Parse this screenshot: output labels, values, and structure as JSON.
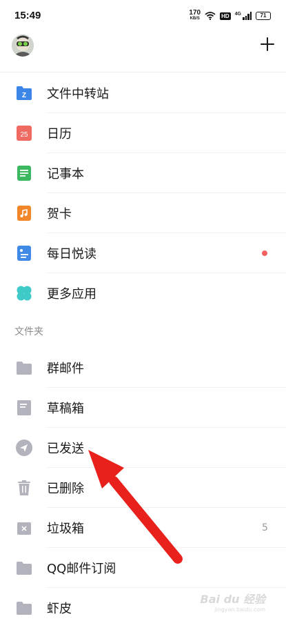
{
  "status_bar": {
    "time": "15:49",
    "net_speed_value": "170",
    "net_speed_unit": "KB/S",
    "hd": "HD",
    "network": "4G",
    "battery": "71"
  },
  "header": {
    "avatar": "avatar",
    "add_icon": "plus-icon"
  },
  "apps": [
    {
      "label": "文件中转站",
      "icon": "file-transfer-icon",
      "color": "#3b86e6"
    },
    {
      "label": "日历",
      "icon": "calendar-icon",
      "color": "#ef6b62",
      "icon_text": "25"
    },
    {
      "label": "记事本",
      "icon": "notepad-icon",
      "color": "#3cb861"
    },
    {
      "label": "贺卡",
      "icon": "greeting-card-icon",
      "color": "#f2872a"
    },
    {
      "label": "每日悦读",
      "icon": "daily-reading-icon",
      "color": "#3f8ae6",
      "has_dot": true
    },
    {
      "label": "更多应用",
      "icon": "more-apps-icon",
      "color": "#3fc9c7"
    }
  ],
  "folders_title": "文件夹",
  "folders": [
    {
      "label": "群邮件",
      "icon": "folder-icon"
    },
    {
      "label": "草稿箱",
      "icon": "drafts-icon"
    },
    {
      "label": "已发送",
      "icon": "sent-icon"
    },
    {
      "label": "已删除",
      "icon": "trash-icon"
    },
    {
      "label": "垃圾箱",
      "icon": "spam-icon",
      "count": "5"
    },
    {
      "label": "QQ邮件订阅",
      "icon": "folder-icon"
    },
    {
      "label": "虾皮",
      "icon": "folder-icon"
    }
  ],
  "watermark": {
    "main": "Bai du 经验",
    "sub": "jingyan.baidu.com"
  },
  "colors": {
    "arrow": "#e8211c",
    "folder_icon": "#b3b3bd"
  }
}
